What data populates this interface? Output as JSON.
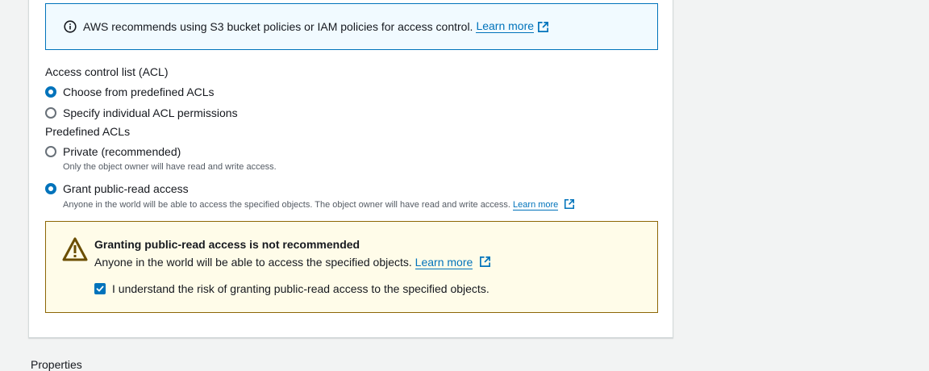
{
  "info": {
    "text": "AWS recommends using S3 bucket policies or IAM policies for access control.",
    "link": "Learn more"
  },
  "acl": {
    "label": "Access control list (ACL)",
    "options": [
      {
        "label": "Choose from predefined ACLs",
        "checked": true
      },
      {
        "label": "Specify individual ACL permissions",
        "checked": false
      }
    ]
  },
  "predefined": {
    "label": "Predefined ACLs",
    "private": {
      "label": "Private (recommended)",
      "description": "Only the object owner will have read and write access.",
      "checked": false
    },
    "public_read": {
      "label": "Grant public-read access",
      "description": "Anyone in the world will be able to access the specified objects. The object owner will have read and write access.",
      "link": "Learn more",
      "checked": true
    }
  },
  "warning": {
    "title": "Granting public-read access is not recommended",
    "text": "Anyone in the world will be able to access the specified objects.",
    "link": "Learn more",
    "checkbox_label": "I understand the risk of granting public-read access to the specified objects.",
    "checkbox_checked": true
  },
  "next_section": {
    "label": "Properties"
  },
  "icons": {
    "info": "info-icon",
    "external": "external-link-icon",
    "warning": "warning-icon",
    "check": "check-icon"
  },
  "colors": {
    "accent": "#0073bb",
    "info_bg": "#f1faff",
    "warning_bg": "#fffce9",
    "warning_border": "#8d6605"
  }
}
